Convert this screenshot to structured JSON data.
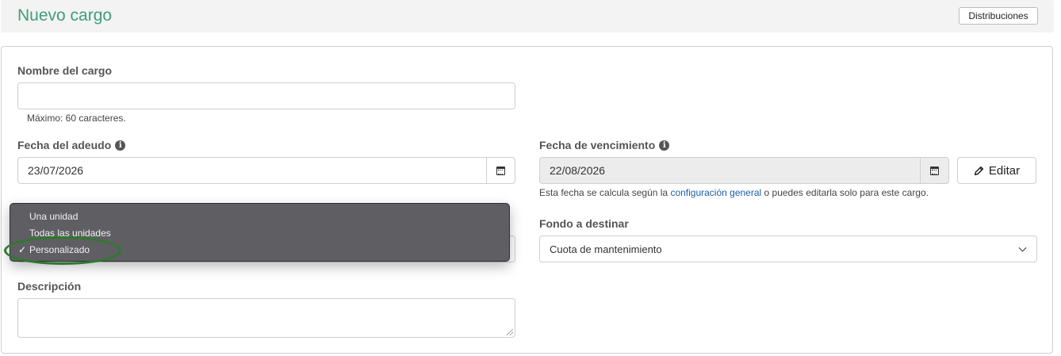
{
  "header": {
    "title": "Nuevo cargo",
    "distribuciones_label": "Distribuciones"
  },
  "form": {
    "nombre": {
      "label": "Nombre del cargo",
      "value": "",
      "help": "Máximo: 60 caracteres."
    },
    "fecha_adeudo": {
      "label": "Fecha del adeudo",
      "value": "23/07/2026"
    },
    "fecha_vencimiento": {
      "label": "Fecha de vencimiento",
      "value": "22/08/2026",
      "help_prefix": "Esta fecha se calcula según la ",
      "help_link": "configuración general",
      "help_suffix": " o puedes editarla solo para este cargo.",
      "edit_label": "Editar"
    },
    "fondo": {
      "label": "Fondo a destinar",
      "value": "Cuota de mantenimiento"
    },
    "descripcion": {
      "label": "Descripción",
      "value": ""
    }
  },
  "dropdown": {
    "options": [
      "Una unidad",
      "Todas las unidades",
      "Personalizado"
    ],
    "selected_index": 2,
    "check_glyph": "✓"
  },
  "colors": {
    "title": "#3f9e78",
    "link": "#1d5fa8",
    "dropdown_bg": "#5f5e63",
    "highlight": "#2d7a2c"
  }
}
